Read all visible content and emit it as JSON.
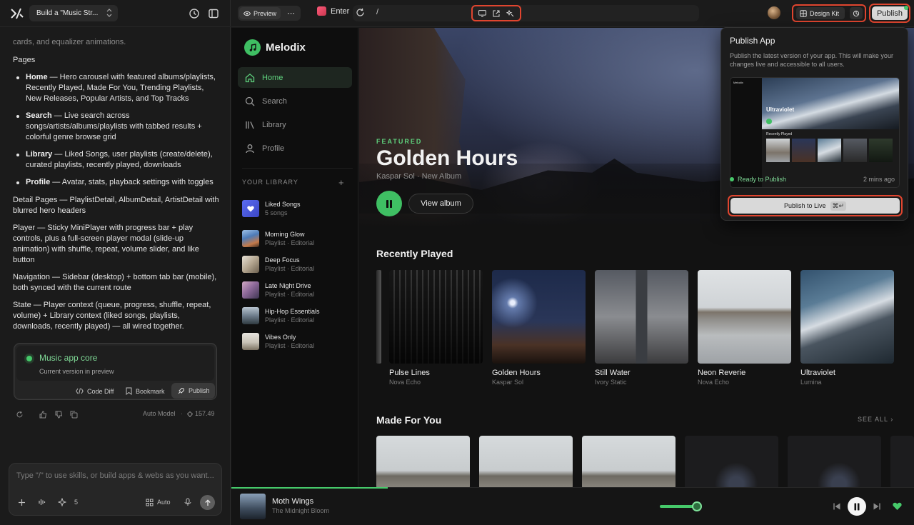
{
  "chat": {
    "project_title": "Build a \"Music Str...",
    "intro_tail": "cards, and equalizer animations.",
    "pages_heading": "Pages",
    "pages": [
      {
        "name": "Home",
        "desc": " — Hero carousel with featured albums/playlists, Recently Played, Made For You, Trending Playlists, New Releases, Popular Artists, and Top Tracks"
      },
      {
        "name": "Search",
        "desc": " — Live search across songs/artists/albums/playlists with tabbed results + colorful genre browse grid"
      },
      {
        "name": "Library",
        "desc": " — Liked Songs, user playlists (create/delete), curated playlists, recently played, downloads"
      },
      {
        "name": "Profile",
        "desc": " — Avatar, stats, playback settings with toggles"
      }
    ],
    "paragraphs": [
      "Detail Pages — PlaylistDetail, AlbumDetail, ArtistDetail with blurred hero headers",
      "Player — Sticky MiniPlayer with progress bar + play controls, plus a full-screen player modal (slide-up animation) with shuffle, repeat, volume slider, and like button",
      "Navigation — Sidebar (desktop) + bottom tab bar (mobile), both synced with the current route",
      "State — Player context (queue, progress, shuffle, repeat, volume) + Library context (liked songs, playlists, downloads, recently played) — all wired together."
    ],
    "version_card": {
      "title": "Music app core",
      "subtitle": "Current version in preview",
      "code_diff": "Code Diff",
      "bookmark": "Bookmark",
      "publish": "Publish"
    },
    "model": "Auto Model",
    "credits": "157.49",
    "input_placeholder": "Type \"/\" to use skills, or build apps & webs as you want...",
    "skills_count": "5",
    "auto_label": "Auto"
  },
  "toolbar": {
    "preview_label": "Preview",
    "enter_label": "Enter",
    "path": "/",
    "design_kit": "Design Kit",
    "publish": "Publish"
  },
  "app": {
    "brand": "Melodix",
    "nav": [
      "Home",
      "Search",
      "Library",
      "Profile"
    ],
    "library_heading": "YOUR LIBRARY",
    "library": [
      {
        "title": "Liked Songs",
        "sub": "5 songs"
      },
      {
        "title": "Morning Glow",
        "sub": "Playlist · Editorial"
      },
      {
        "title": "Deep Focus",
        "sub": "Playlist · Editorial"
      },
      {
        "title": "Late Night Drive",
        "sub": "Playlist · Editorial"
      },
      {
        "title": "Hip-Hop Essentials",
        "sub": "Playlist · Editorial"
      },
      {
        "title": "Vibes Only",
        "sub": "Playlist · Editorial"
      }
    ],
    "hero": {
      "label": "FEATURED",
      "title": "Golden Hours",
      "subtitle": "Kaspar Sol · New Album",
      "view_album": "View album"
    },
    "recently_played_title": "Recently Played",
    "recently_played": [
      {
        "title": "Pulse Lines",
        "artist": "Nova Echo"
      },
      {
        "title": "Golden Hours",
        "artist": "Kaspar Sol"
      },
      {
        "title": "Still Water",
        "artist": "Ivory Static"
      },
      {
        "title": "Neon Reverie",
        "artist": "Nova Echo"
      },
      {
        "title": "Ultraviolet",
        "artist": "Lumina"
      }
    ],
    "made_for_you_title": "Made For You",
    "see_all": "SEE ALL",
    "player": {
      "title": "Moth Wings",
      "artist": "The Midnight Bloom",
      "progress": 0.35,
      "volume": 0.8
    }
  },
  "popover": {
    "title": "Publish App",
    "description": "Publish the latest version of your app. This will make your changes live and accessible to all users.",
    "shot_brand": "Melodix",
    "shot_title": "Ultraviolet",
    "shot_section": "Recently Played",
    "status": "Ready to Publish",
    "time": "2 mins ago",
    "button": "Publish to Live",
    "shortcut": "⌘↵"
  },
  "colors": {
    "accent_green": "#3fbf63",
    "highlight_red": "#e0452f"
  }
}
